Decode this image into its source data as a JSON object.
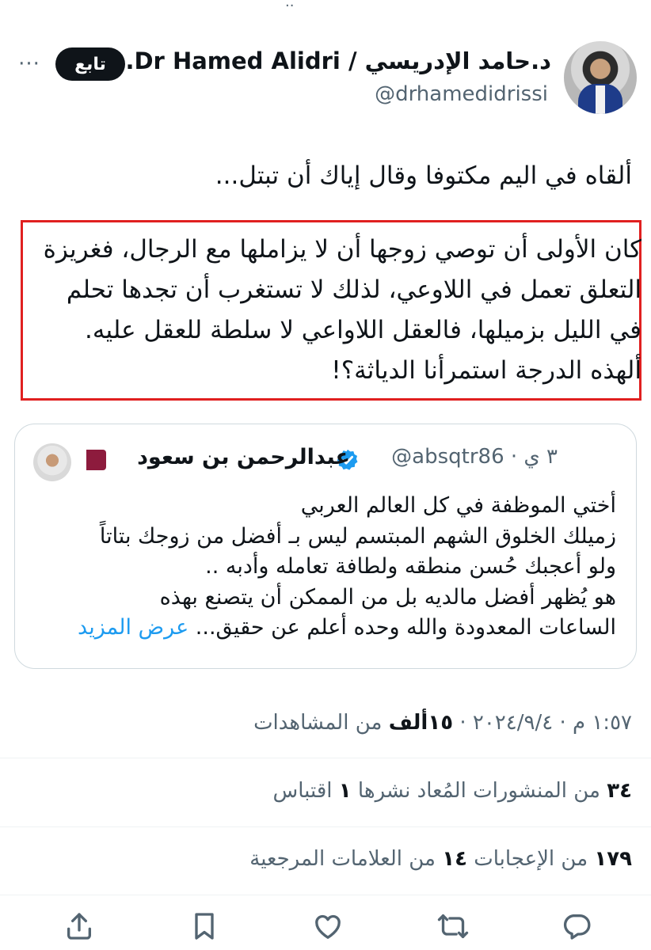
{
  "top_dots": "..",
  "author": {
    "display_name": "د.حامد الإدريسي / Dr Hamed Alidri...",
    "handle": "@drhamedidrissi",
    "follow_label": "تابع",
    "more_icon": "more-dots-icon"
  },
  "tweet": {
    "line1": "ألقاه في اليم مكتوفا وقال إياك أن تبتل...",
    "highlighted_lines": [
      "كان الأولى أن توصي زوجها أن لا يزاملها مع الرجال، فغريزة",
      "التعلق تعمل في اللاوعي، لذلك لا تستغرب أن تجدها تحلم",
      "في الليل بزميلها، فالعقل اللاواعي لا سلطة للعقل عليه.",
      "ألهذه الدرجة استمرأنا الدياثة؟!"
    ],
    "highlight_color": "#e02020"
  },
  "quote": {
    "name": "عبدالرحمن بن سعود",
    "handle_time": "@absqtr86 · ٣ ي",
    "verified_color": "#1d9bf0",
    "flag_colors": [
      "#ffffff",
      "#8d1b3d"
    ],
    "lines": [
      "أختي الموظفة في كل العالم العربي",
      "زميلك الخلوق الشهم المبتسم ليس بـ أفضل من زوجك بتاتاً",
      "ولو أعجبك حُسن منطقه ولطافة تعامله وأدبه ..",
      "هو يُظهر أفضل مالديه بل من الممكن أن يتصنع بهذه"
    ],
    "last_line": "الساعات المعدودة والله وحده أعلم عن حقيق...",
    "show_more": "عرض المزيد"
  },
  "meta": {
    "date_time": "١:٥٧ م · ٢٠٢٤/٩/٤ · ",
    "views_count": "١٥ألف",
    "views_label": " من المشاهدات"
  },
  "stats": {
    "reposts_count": "٣٤",
    "reposts_label": " من المنشورات المُعاد نشرها ",
    "quotes_count": "١",
    "quotes_label": " اقتباس",
    "likes_count": "١٧٩",
    "likes_label": " من الإعجابات ",
    "bookmarks_count": "١٤",
    "bookmarks_label": " من العلامات المرجعية"
  },
  "actions": [
    "reply-icon",
    "repost-icon",
    "like-icon",
    "bookmark-icon",
    "share-icon"
  ],
  "colors": {
    "text": "#0f1419",
    "secondary": "#536471",
    "border": "#cfd9de",
    "link": "#1d9bf0"
  }
}
